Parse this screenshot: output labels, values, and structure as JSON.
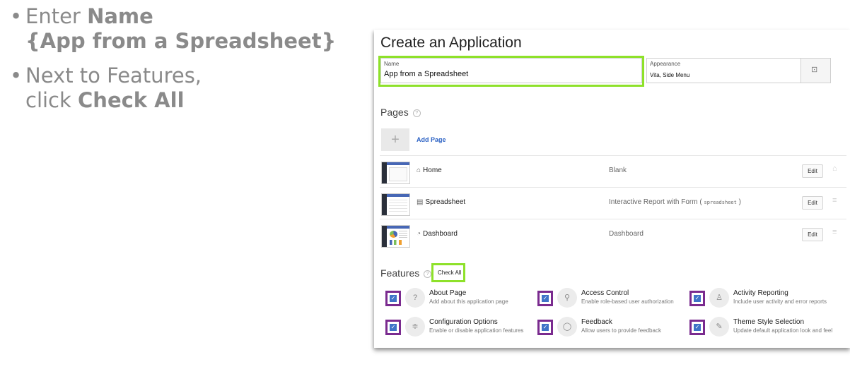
{
  "instructions": {
    "step1_prefix": "Enter ",
    "step1_bold": "Name",
    "step1_bold2": "{App from a Spreadsheet}",
    "step2_line1": "Next to Features,",
    "step2_prefix": "click ",
    "step2_bold": "Check All"
  },
  "panel": {
    "title": "Create an Application",
    "name_label": "Name",
    "name_value": "App from a Spreadsheet",
    "appearance_label": "Appearance",
    "appearance_value": "Vita, Side Menu",
    "pages_label": "Pages",
    "add_page": "Add Page",
    "pages": [
      {
        "name": "Home",
        "type": "Blank",
        "icon": "home-icon",
        "edit": "Edit"
      },
      {
        "name": "Spreadsheet",
        "type_prefix": "Interactive Report with Form ( ",
        "type_code": "spreadsheet",
        "type_suffix": " )",
        "icon": "grid-icon",
        "edit": "Edit"
      },
      {
        "name": "Dashboard",
        "type": "Dashboard",
        "icon": "dashboard-icon",
        "edit": "Edit"
      }
    ],
    "features_label": "Features",
    "check_all": "Check All",
    "features": [
      {
        "title": "About Page",
        "desc": "Add about this application page",
        "icon": "question-icon"
      },
      {
        "title": "Access Control",
        "desc": "Enable role-based user authorization",
        "icon": "key-icon"
      },
      {
        "title": "Activity Reporting",
        "desc": "Include user activity and error reports",
        "icon": "user-activity-icon"
      },
      {
        "title": "Configuration Options",
        "desc": "Enable or disable application features",
        "icon": "sliders-icon"
      },
      {
        "title": "Feedback",
        "desc": "Allow users to provide feedback",
        "icon": "speech-bubble-icon"
      },
      {
        "title": "Theme Style Selection",
        "desc": "Update default application look and feel",
        "icon": "brush-icon"
      }
    ]
  },
  "colors": {
    "highlight_green": "#8ee12a",
    "highlight_purple": "#7a2b8f",
    "checkbox_blue": "#3f74c8"
  }
}
